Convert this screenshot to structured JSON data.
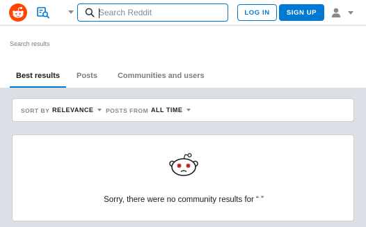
{
  "header": {
    "search": {
      "placeholder": "Search Reddit",
      "value": ""
    },
    "login_label": "LOG IN",
    "signup_label": "SIGN UP",
    "icons": [
      "reddit-logo-icon",
      "feed-icon",
      "chevron-down-icon",
      "search-icon",
      "user-icon"
    ]
  },
  "page": {
    "title": "Search results"
  },
  "tabs": [
    {
      "label": "Best results",
      "active": true
    },
    {
      "label": "Posts",
      "active": false
    },
    {
      "label": "Communities and users",
      "active": false
    }
  ],
  "sort_bar": {
    "sort_label": "SORT BY",
    "sort_value": "RELEVANCE",
    "from_label": "POSTS FROM",
    "from_value": "ALL TIME"
  },
  "results": {
    "empty_message": "Sorry, there were no community results for “ ”"
  },
  "colors": {
    "accent": "#0079d3",
    "brand": "#ff4500",
    "background": "#dae0e6"
  }
}
